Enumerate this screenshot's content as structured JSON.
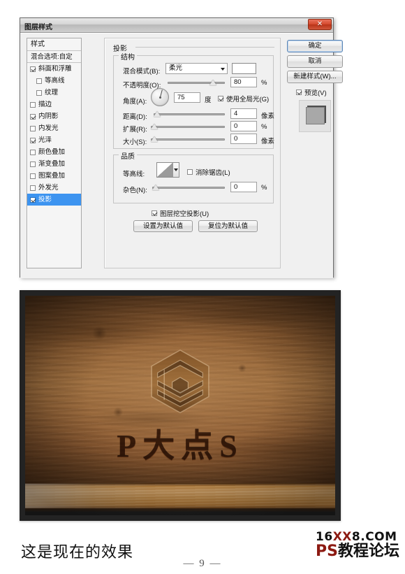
{
  "dialog": {
    "title": "图层样式",
    "close_label": "✕",
    "styles_panel": {
      "header": "样式",
      "blend_options": "混合选项:自定",
      "items": [
        {
          "label": "斜面和浮雕",
          "checked": true,
          "indent": false,
          "selected": false
        },
        {
          "label": "等高线",
          "checked": false,
          "indent": true,
          "selected": false
        },
        {
          "label": "纹理",
          "checked": false,
          "indent": true,
          "selected": false
        },
        {
          "label": "描边",
          "checked": false,
          "indent": false,
          "selected": false
        },
        {
          "label": "内阴影",
          "checked": true,
          "indent": false,
          "selected": false
        },
        {
          "label": "内发光",
          "checked": false,
          "indent": false,
          "selected": false
        },
        {
          "label": "光泽",
          "checked": true,
          "indent": false,
          "selected": false
        },
        {
          "label": "颜色叠加",
          "checked": false,
          "indent": false,
          "selected": false
        },
        {
          "label": "渐变叠加",
          "checked": false,
          "indent": false,
          "selected": false
        },
        {
          "label": "图案叠加",
          "checked": false,
          "indent": false,
          "selected": false
        },
        {
          "label": "外发光",
          "checked": false,
          "indent": false,
          "selected": false
        },
        {
          "label": "投影",
          "checked": true,
          "indent": false,
          "selected": true
        }
      ]
    },
    "main": {
      "panel_title": "投影",
      "structure": {
        "legend": "结构",
        "blend_mode_label": "混合模式(B):",
        "blend_mode_value": "柔光",
        "color_swatch": "#ffffff",
        "opacity_label": "不透明度(O):",
        "opacity_value": "80",
        "opacity_unit": "%",
        "angle_label": "角度(A):",
        "angle_value": "75",
        "angle_unit": "度",
        "global_light_label": "使用全局光(G)",
        "global_light_checked": true,
        "distance_label": "距离(D):",
        "distance_value": "4",
        "distance_unit": "像素",
        "spread_label": "扩展(R):",
        "spread_value": "0",
        "spread_unit": "%",
        "size_label": "大小(S):",
        "size_value": "0",
        "size_unit": "像素"
      },
      "quality": {
        "legend": "品质",
        "contour_label": "等高线:",
        "antialias_label": "消除锯齿(L)",
        "antialias_checked": false,
        "noise_label": "杂色(N):",
        "noise_value": "0",
        "noise_unit": "%"
      },
      "knockout_label": "图层挖空投影(U)",
      "knockout_checked": true,
      "set_default_button": "设置为默认值",
      "reset_default_button": "复位为默认值"
    },
    "right": {
      "ok_button": "确定",
      "cancel_button": "取消",
      "new_style_button": "新建样式(W)...",
      "preview_label": "预览(V)",
      "preview_checked": true
    }
  },
  "photo": {
    "wordmark": "P大点S",
    "logo_name": "hexagon-layers-logo"
  },
  "footer": {
    "caption": "这是现在的效果",
    "page_number": "— 9 —",
    "watermark": {
      "line1_a": "16",
      "line1_b": "XX",
      "line1_c": "8.COM",
      "line2_a": "PS",
      "line2_b": "教程论坛"
    }
  }
}
